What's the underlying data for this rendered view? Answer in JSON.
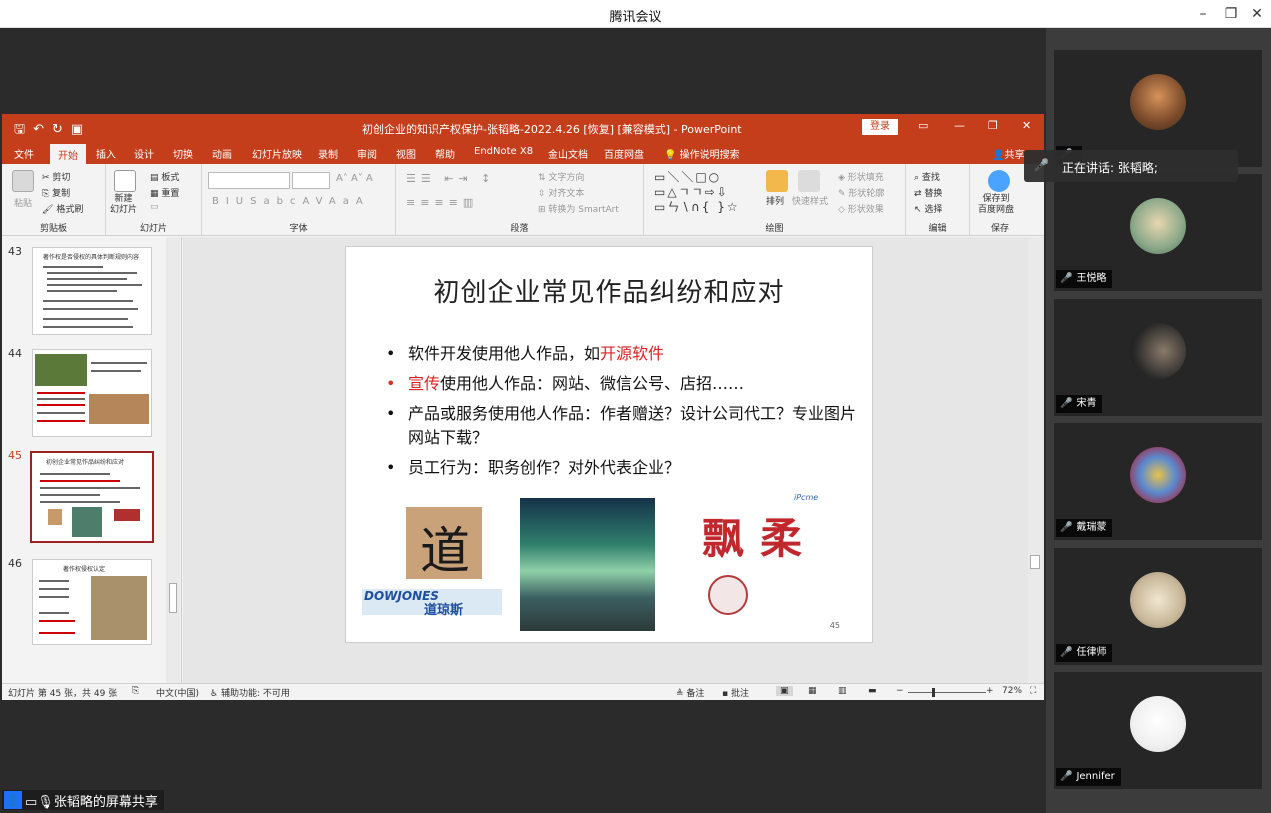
{
  "meeting": {
    "title": "腾讯会议",
    "speaking_label": "正在讲话: 张韬略;",
    "share_label": "张韬略的屏幕共享"
  },
  "ppt": {
    "doc_title": "初创企业的知识产权保护-张韬略-2022.4.26 [恢复] [兼容模式]  -  PowerPoint",
    "login_label": "登录",
    "share_label": "共享",
    "tabs": [
      "文件",
      "开始",
      "插入",
      "设计",
      "切换",
      "动画",
      "幻灯片放映",
      "录制",
      "审阅",
      "视图",
      "帮助",
      "EndNote X8",
      "金山文档",
      "百度网盘",
      "操作说明搜索"
    ],
    "ribbon": {
      "clipboard": {
        "label": "剪贴板",
        "paste": "粘贴",
        "cut": "剪切",
        "copy": "复制",
        "format_painter": "格式刷"
      },
      "slides": {
        "label": "幻灯片",
        "new_slide": "新建\n幻灯片",
        "layout": "板式",
        "reset": "重置"
      },
      "font": {
        "label": "字体"
      },
      "paragraph": {
        "label": "段落",
        "text_direction": "文字方向",
        "align_text": "对齐文本",
        "smartart": "转换为 SmartArt"
      },
      "drawing": {
        "label": "绘图",
        "arrange": "排列",
        "quick_styles": "快速样式",
        "shape_fill": "形状填充",
        "shape_outline": "形状轮廓",
        "shape_effects": "形状效果"
      },
      "editing": {
        "label": "编辑",
        "find": "查找",
        "replace": "替换",
        "select": "选择"
      },
      "save": {
        "label": "保存",
        "save_baidu": "保存到\n百度网盘"
      }
    },
    "thumbnails": [
      {
        "num": "43",
        "title": "著作权是否侵权的具体判断规则内容"
      },
      {
        "num": "44",
        "title": ""
      },
      {
        "num": "45",
        "title": "初创企业常见作品纠纷和应对",
        "selected": true
      },
      {
        "num": "46",
        "title": "著作权侵权认定"
      }
    ],
    "slide": {
      "title": "初创企业常见作品纠纷和应对",
      "bullets": [
        {
          "text": "软件开发使用他人作品，如",
          "highlight": "开源软件",
          "after": ""
        },
        {
          "text": "",
          "highlight": "宣传",
          "after": "使用他人作品：网站、微信公号、店招……"
        },
        {
          "text": "产品或服务使用他人作品：作者赠送？设计公司代工？专业图片网站下载？",
          "highlight": "",
          "after": ""
        },
        {
          "text": "员工行为：职务创作？对外代表企业？",
          "highlight": "",
          "after": ""
        }
      ],
      "logo_dow_en": "DOWJONES",
      "logo_dow_cn": "道琼斯",
      "calligraphy_dao": "道",
      "piaorou": "飘柔",
      "pcme": "iPcme",
      "slide_number": "45"
    },
    "status": {
      "slide_info": "幻灯片 第 45 张，共 49 张",
      "language": "中文(中国)",
      "accessibility": "辅助功能: 不可用",
      "notes": "备注",
      "comments": "批注",
      "zoom": "72%"
    }
  },
  "participants": [
    {
      "name": ""
    },
    {
      "name": "王悦略"
    },
    {
      "name": "宋青"
    },
    {
      "name": "戴瑞蒙"
    },
    {
      "name": "任律师"
    },
    {
      "name": "Jennifer"
    }
  ],
  "colors": {
    "ppt_accent": "#c43e1c",
    "selected_thumb": "#9b2423",
    "highlight_text": "#dd2222"
  }
}
